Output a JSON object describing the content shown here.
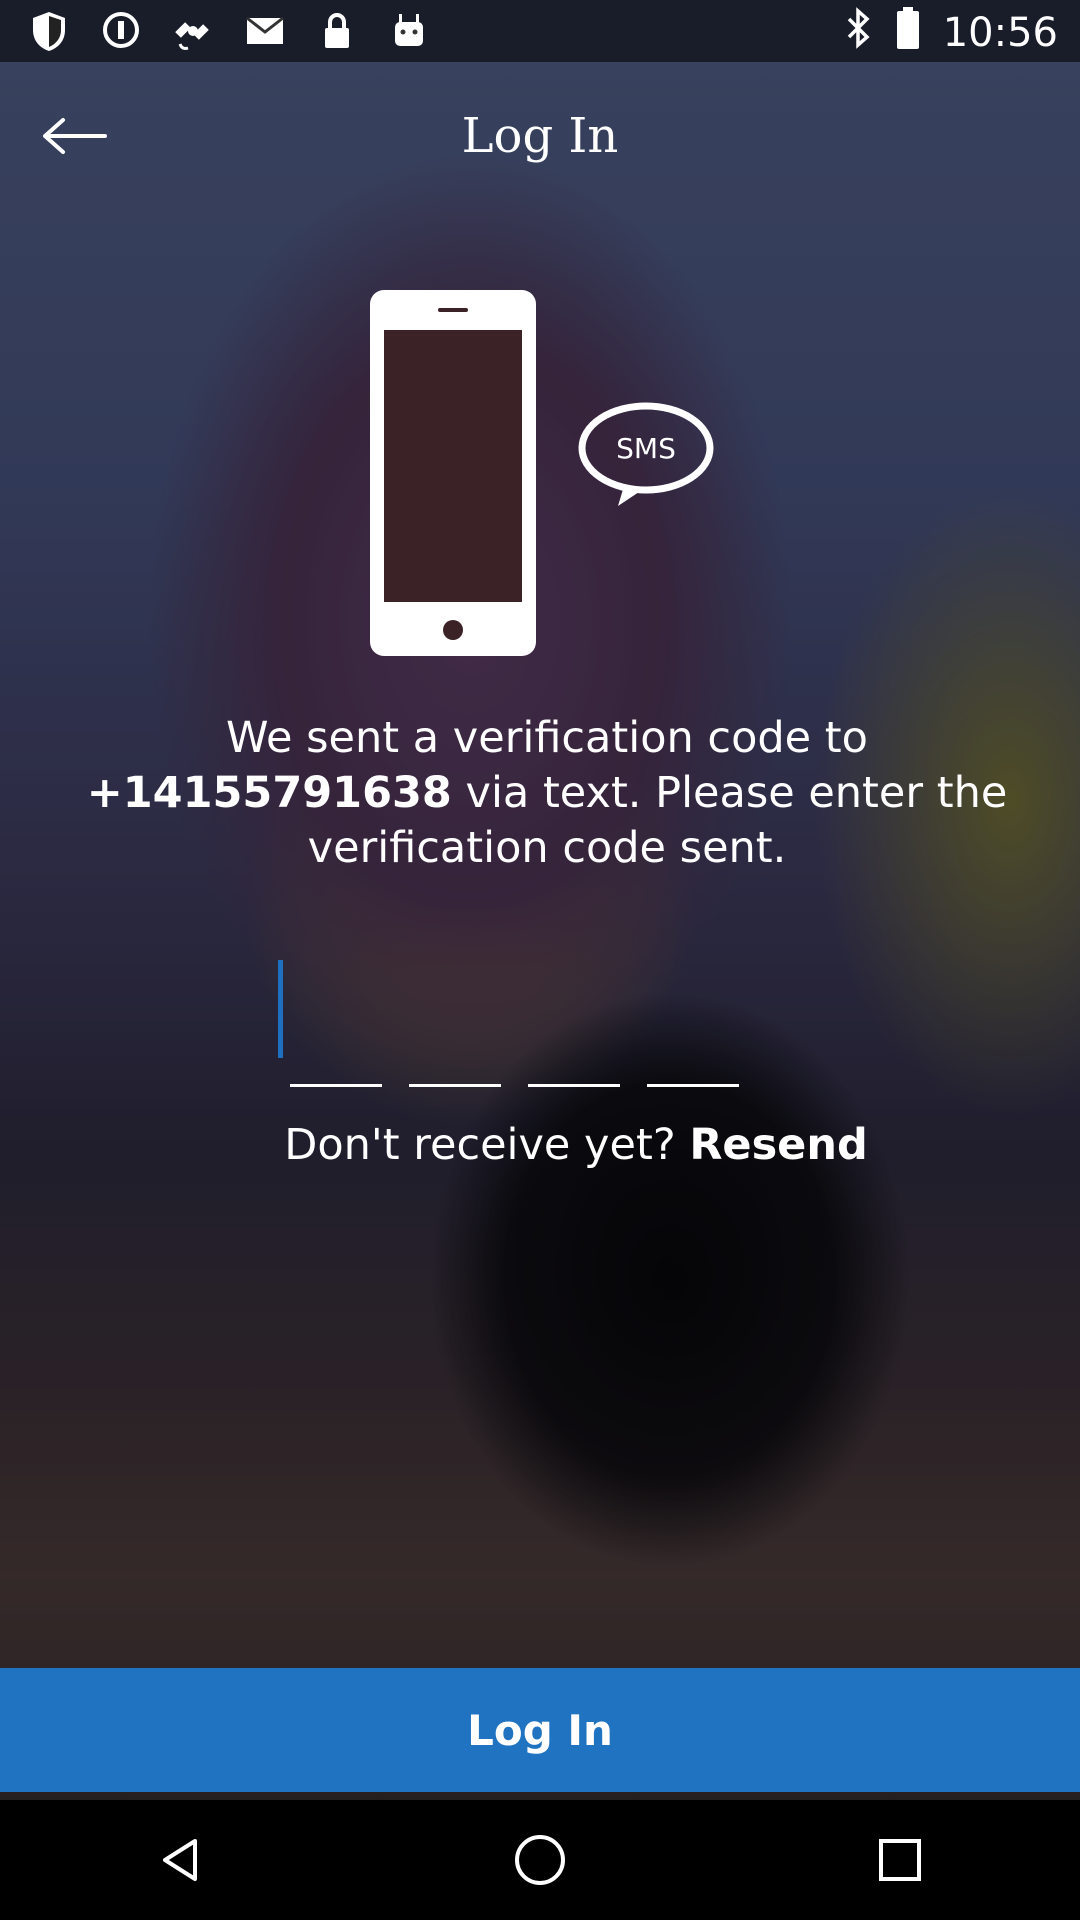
{
  "status_bar": {
    "time": "10:56",
    "left_icons": [
      "shield-icon",
      "info-icon",
      "satellite-icon",
      "mail-icon",
      "lock-icon",
      "android-icon"
    ],
    "right_icons": [
      "bluetooth-icon",
      "battery-icon"
    ]
  },
  "app_bar": {
    "back_icon": "back-arrow-icon",
    "title": "Log In"
  },
  "hero": {
    "phone_icon": "phone-icon",
    "sms_label": "SMS"
  },
  "message": {
    "line1": "We sent a verification code to",
    "phone_number": "+14155791638",
    "line2_rest": " via text. Please enter the",
    "line3": "verification code sent."
  },
  "code_input": {
    "slots": 4,
    "value": ""
  },
  "resend": {
    "prompt": "Don't receive yet? ",
    "link": "Resend"
  },
  "login_button": {
    "label": "Log In"
  },
  "colors": {
    "accent": "#1f73c0",
    "cursor": "#1f6fc0"
  },
  "nav_bar": {
    "back_icon": "triangle-back-icon",
    "home_icon": "circle-home-icon",
    "recents_icon": "square-recents-icon"
  }
}
